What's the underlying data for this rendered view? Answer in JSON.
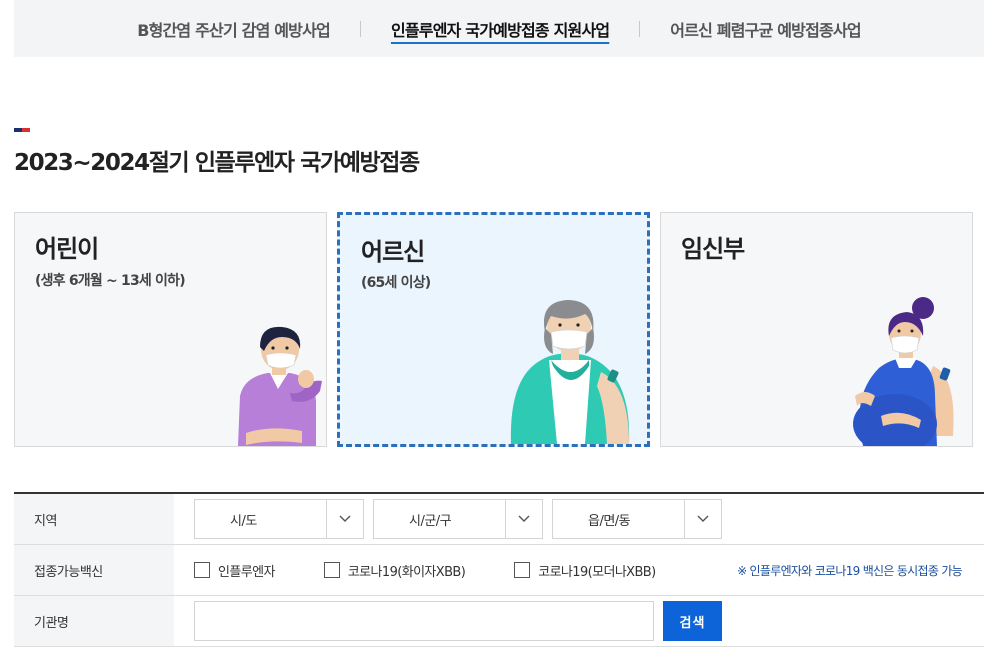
{
  "top_tabs": [
    {
      "label": "B형간염 주산기 감염 예방사업",
      "active": false
    },
    {
      "label": "인플루엔자 국가예방접종 지원사업",
      "active": true
    },
    {
      "label": "어르신 폐렴구균 예방접종사업",
      "active": false
    }
  ],
  "section": {
    "title": "2023~2024절기 인플루엔자 국가예방접종"
  },
  "cards": [
    {
      "title": "어린이",
      "subtitle": "(생후 6개월 ~ 13세 이하)"
    },
    {
      "title": "어르신",
      "subtitle": "(65세 이상)"
    },
    {
      "title": "임신부",
      "subtitle": ""
    }
  ],
  "search": {
    "region": {
      "label": "지역",
      "sido": "시/도",
      "sigungu": "시/군/구",
      "eupmyeondong": "읍/면/동"
    },
    "vaccine": {
      "label": "접종가능백신",
      "options": [
        "인플루엔자",
        "코로나19(화이자XBB)",
        "코로나19(모더나XBB)"
      ],
      "notice": "※ 인플루엔자와 코로나19 백신은 동시접종 가능"
    },
    "org": {
      "label": "기관명",
      "value": "",
      "button": "검색"
    }
  },
  "colors": {
    "accent": "#0c64d8",
    "selected_border": "#2e6fba",
    "title_bar_navy": "#1c2f6e",
    "title_bar_red": "#d6322f"
  }
}
